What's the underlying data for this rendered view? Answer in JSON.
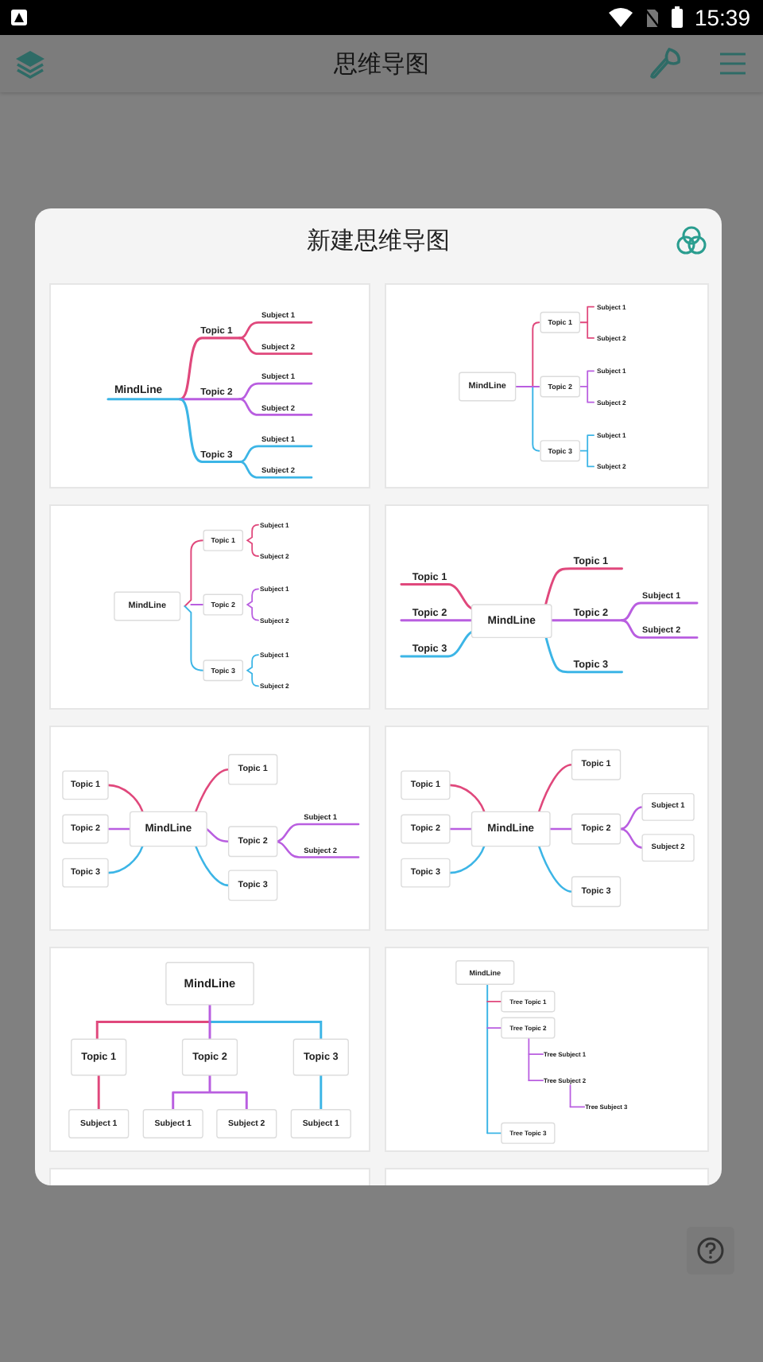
{
  "status_bar": {
    "time": "15:39"
  },
  "app_bar": {
    "title": "思维导图"
  },
  "dialog": {
    "title": "新建思维导图",
    "templates": [
      {
        "kind": "logic",
        "root": "MindLine",
        "topics": [
          {
            "label": "Topic 1",
            "subjects": [
              "Subject 1",
              "Subject 2"
            ]
          },
          {
            "label": "Topic 2",
            "subjects": [
              "Subject 1",
              "Subject 2"
            ]
          },
          {
            "label": "Topic 3",
            "subjects": [
              "Subject 1",
              "Subject 2"
            ]
          }
        ]
      },
      {
        "kind": "bracket",
        "root": "MindLine",
        "topics": [
          {
            "label": "Topic 1",
            "subjects": [
              "Subject 1",
              "Subject 2"
            ]
          },
          {
            "label": "Topic 2",
            "subjects": [
              "Subject 1",
              "Subject 2"
            ]
          },
          {
            "label": "Topic 3",
            "subjects": [
              "Subject 1",
              "Subject 2"
            ]
          }
        ]
      },
      {
        "kind": "brace",
        "root": "MindLine",
        "topics": [
          {
            "label": "Topic 1",
            "subjects": [
              "Subject 1",
              "Subject 2"
            ]
          },
          {
            "label": "Topic 2",
            "subjects": [
              "Subject 1",
              "Subject 2"
            ]
          },
          {
            "label": "Topic 3",
            "subjects": [
              "Subject 1",
              "Subject 2"
            ]
          }
        ]
      },
      {
        "kind": "balanced-lines",
        "root": "MindLine",
        "left": [
          "Topic 1",
          "Topic 2",
          "Topic 3"
        ],
        "right": [
          {
            "label": "Topic 1"
          },
          {
            "label": "Topic 2",
            "subjects": [
              "Subject 1",
              "Subject 2"
            ]
          },
          {
            "label": "Topic 3"
          }
        ]
      },
      {
        "kind": "balanced-boxes",
        "root": "MindLine",
        "left": [
          "Topic 1",
          "Topic 2",
          "Topic 3"
        ],
        "right": [
          {
            "label": "Topic 1"
          },
          {
            "label": "Topic 2",
            "subjects": [
              "Subject 1",
              "Subject 2"
            ]
          },
          {
            "label": "Topic 3"
          }
        ]
      },
      {
        "kind": "balanced-boxes-framed",
        "root": "MindLine",
        "left": [
          "Topic 1",
          "Topic 2",
          "Topic 3"
        ],
        "right": [
          {
            "label": "Topic 1"
          },
          {
            "label": "Topic 2",
            "subjects": [
              "Subject 1",
              "Subject 2"
            ]
          },
          {
            "label": "Topic 3"
          }
        ]
      },
      {
        "kind": "org",
        "root": "MindLine",
        "topics": [
          {
            "label": "Topic 1",
            "subjects": [
              "Subject 1"
            ]
          },
          {
            "label": "Topic 2",
            "subjects": [
              "Subject 1",
              "Subject 2"
            ]
          },
          {
            "label": "Topic 3",
            "subjects": [
              "Subject 1"
            ]
          }
        ]
      },
      {
        "kind": "tree",
        "root": "MindLine",
        "topics": [
          {
            "label": "Tree Topic 1"
          },
          {
            "label": "Tree Topic 2",
            "children": [
              {
                "label": "Tree Subject 1"
              },
              {
                "label": "Tree Subject 2",
                "children": [
                  {
                    "label": "Tree Subject 3"
                  }
                ]
              }
            ]
          },
          {
            "label": "Tree Topic 3"
          }
        ]
      },
      {
        "kind": "cut"
      },
      {
        "kind": "cut"
      }
    ]
  }
}
